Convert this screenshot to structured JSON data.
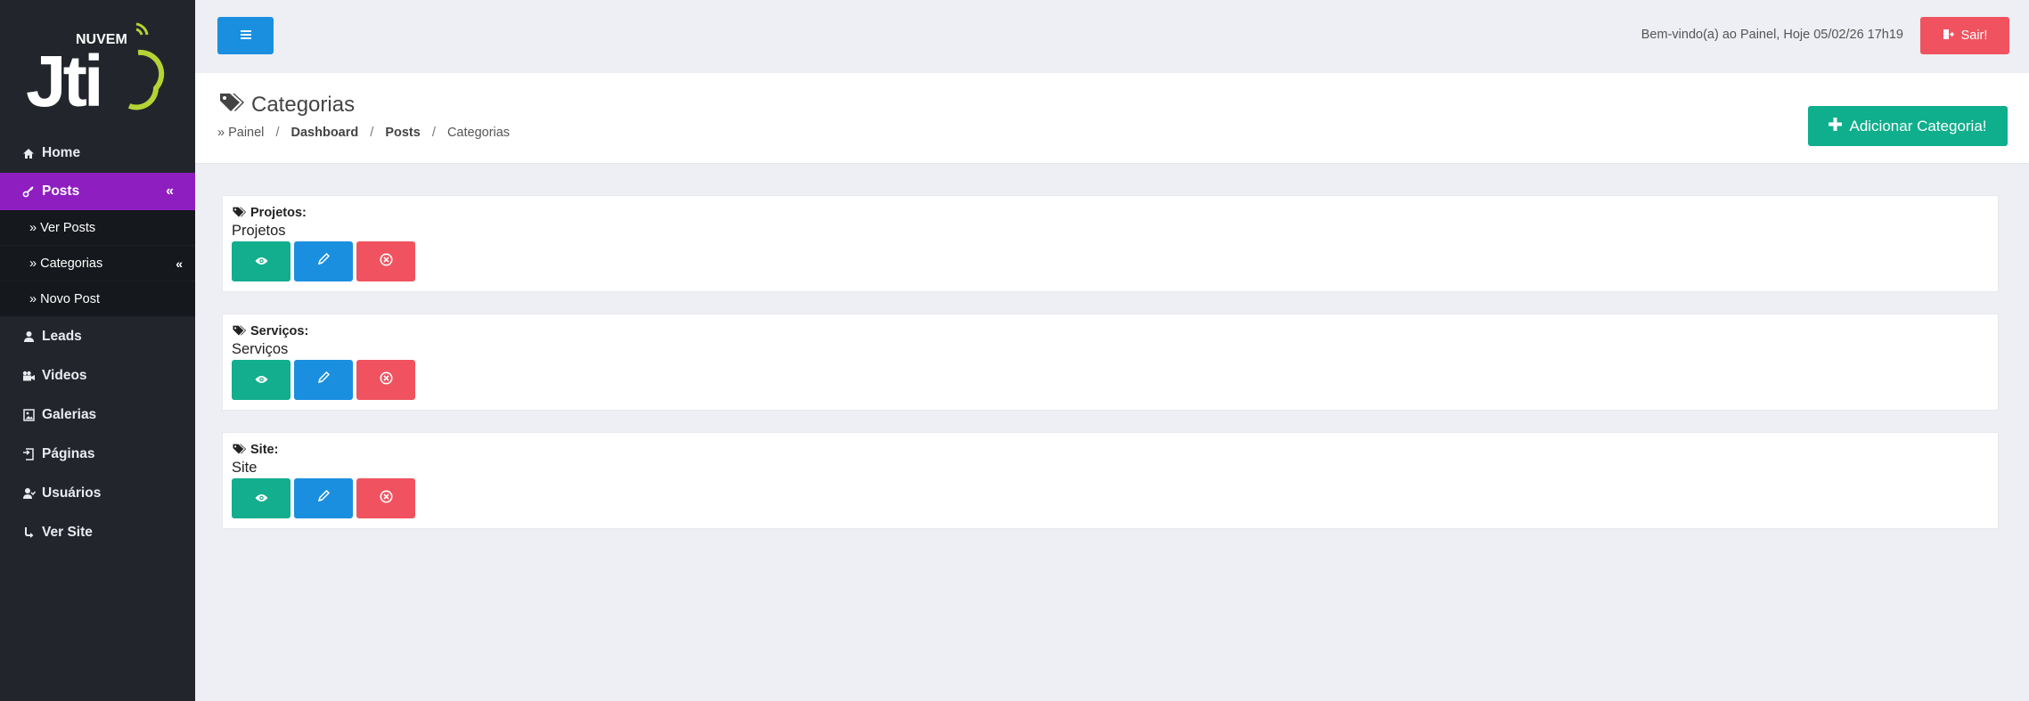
{
  "logo": {
    "brand_top": "NUVEM",
    "brand_main": "Jti"
  },
  "sidebar": {
    "items": [
      {
        "label": "Home",
        "icon": "home-icon"
      },
      {
        "label": "Posts",
        "icon": "posts-icon",
        "chevron": "«",
        "active": true
      },
      {
        "label": "Leads",
        "icon": "user-icon"
      },
      {
        "label": "Videos",
        "icon": "video-icon"
      },
      {
        "label": "Galerias",
        "icon": "image-icon"
      },
      {
        "label": "Páginas",
        "icon": "pages-icon"
      },
      {
        "label": "Usuários",
        "icon": "users-icon"
      },
      {
        "label": "Ver Site",
        "icon": "share-icon"
      }
    ],
    "sub_items": [
      {
        "label": "» Ver Posts"
      },
      {
        "label": "» Categorias",
        "chevron": "«"
      },
      {
        "label": "» Novo Post"
      }
    ]
  },
  "header": {
    "welcome": "Bem-vindo(a) ao Painel, Hoje 05/02/26 17h19",
    "logout_label": "Sair!"
  },
  "page": {
    "title": "Categorias",
    "breadcrumb": {
      "prefix": "» Painel",
      "sep": "/",
      "dashboard": "Dashboard",
      "posts": "Posts",
      "current": "Categorias"
    },
    "add_label": "Adicionar Categoria!"
  },
  "categories": [
    {
      "label": "Projetos:",
      "value": "Projetos"
    },
    {
      "label": "Serviços:",
      "value": "Serviços"
    },
    {
      "label": "Site:",
      "value": "Site"
    }
  ],
  "colors": {
    "sidebar_bg": "#22262c",
    "active": "#8e1ec0",
    "primary": "#1a8fe0",
    "success": "#0fae8c",
    "danger": "#f0535f",
    "logo_accent": "#b5d334"
  }
}
